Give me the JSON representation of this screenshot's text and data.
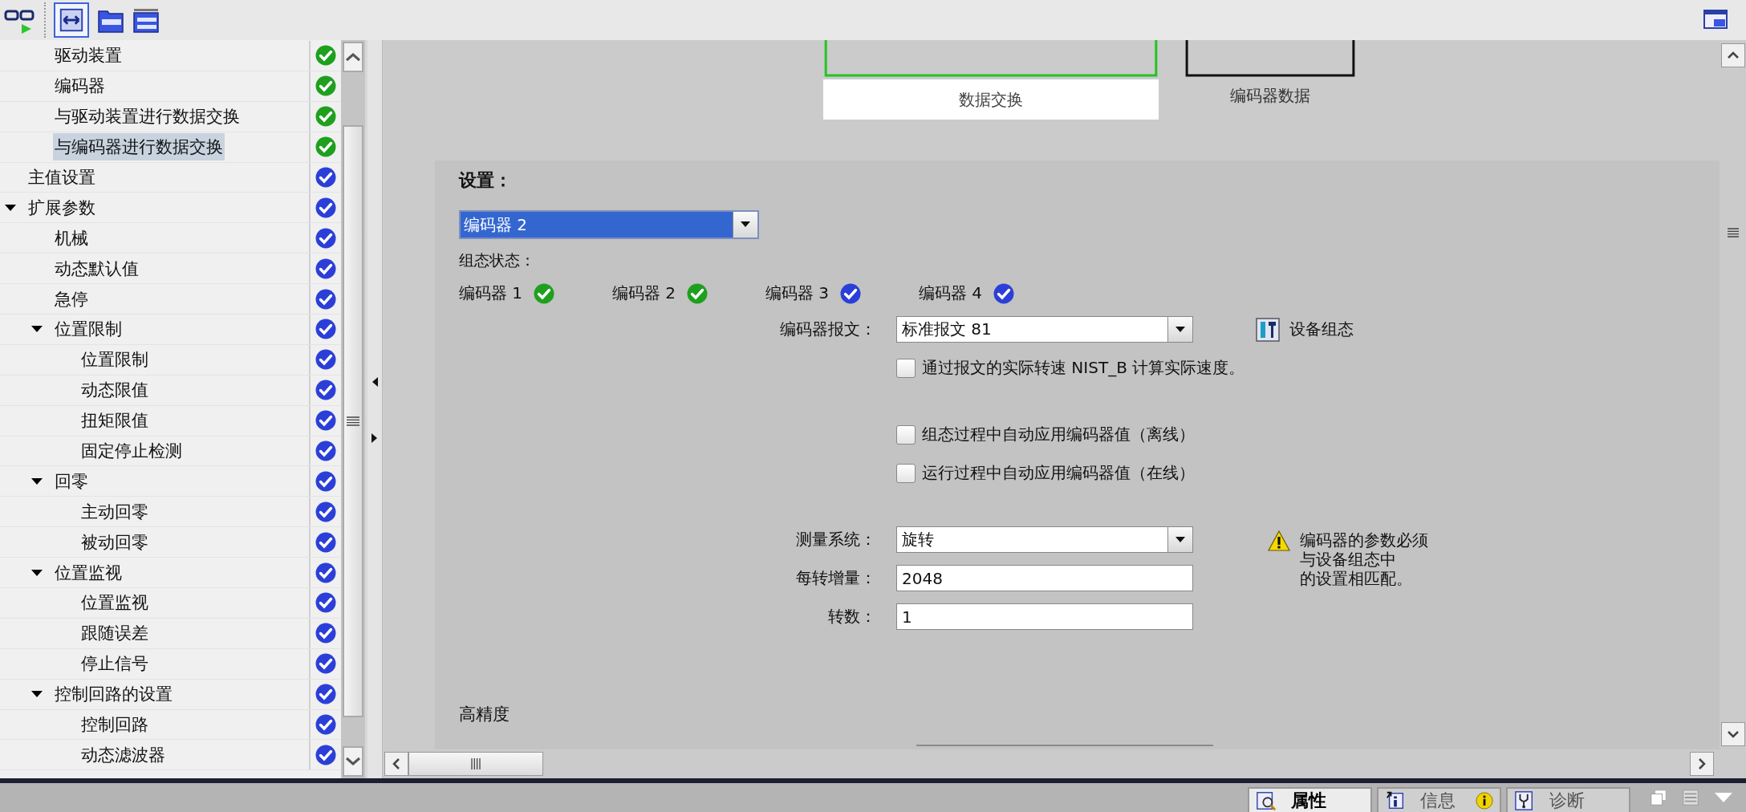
{
  "tree": {
    "items": [
      {
        "children": [
          {
            "label": "驱动装置",
            "selected": false,
            "color": "#1ea01e"
          },
          {
            "label": "编码器",
            "selected": false,
            "color": "#1ea01e"
          },
          {
            "label": "与驱动装置进行数据交换",
            "selected": false,
            "color": "#1ea01e"
          },
          {
            "label": "与编码器进行数据交换",
            "selected": true,
            "color": "#1ea01e"
          }
        ]
      },
      {
        "label": "主值设置",
        "selected": false,
        "color": "#2b3fd8"
      },
      {
        "label": "扩展参数",
        "selected": false,
        "color": "#2b3fd8",
        "expanded": true,
        "children": [
          {
            "label": "机械",
            "selected": false,
            "color": "#2b3fd8"
          },
          {
            "label": "动态默认值",
            "selected": false,
            "color": "#2b3fd8"
          },
          {
            "label": "急停",
            "selected": false,
            "color": "#2b3fd8"
          },
          {
            "label": "位置限制",
            "selected": false,
            "color": "#2b3fd8",
            "expanded": true,
            "children": [
              {
                "label": "位置限制",
                "selected": false,
                "color": "#2b3fd8"
              },
              {
                "label": "动态限值",
                "selected": false,
                "color": "#2b3fd8"
              },
              {
                "label": "扭矩限值",
                "selected": false,
                "color": "#2b3fd8"
              },
              {
                "label": "固定停止检测",
                "selected": false,
                "color": "#2b3fd8"
              }
            ]
          },
          {
            "label": "回零",
            "selected": false,
            "color": "#2b3fd8",
            "expanded": true,
            "children": [
              {
                "label": "主动回零",
                "selected": false,
                "color": "#2b3fd8"
              },
              {
                "label": "被动回零",
                "selected": false,
                "color": "#2b3fd8"
              }
            ]
          },
          {
            "label": "位置监视",
            "selected": false,
            "color": "#2b3fd8",
            "expanded": true,
            "children": [
              {
                "label": "位置监视",
                "selected": false,
                "color": "#2b3fd8"
              },
              {
                "label": "跟随误差",
                "selected": false,
                "color": "#2b3fd8"
              },
              {
                "label": "停止信号",
                "selected": false,
                "color": "#2b3fd8"
              }
            ]
          },
          {
            "label": "控制回路的设置",
            "selected": false,
            "color": "#2b3fd8",
            "expanded": true,
            "children": [
              {
                "label": "控制回路",
                "selected": false,
                "color": "#2b3fd8"
              },
              {
                "label": "动态滤波器",
                "selected": false,
                "color": "#2b3fd8"
              }
            ]
          }
        ]
      }
    ]
  },
  "diagram": {
    "blocks": [
      {
        "label": "数据交换",
        "kind": "boxed",
        "color": "#22c422"
      },
      {
        "label": "编码器数据",
        "kind": "plain",
        "color": "#111111"
      }
    ]
  },
  "settings": {
    "title": "设置：",
    "encoder_select": {
      "value": "编码器 2"
    },
    "status_label": "组态状态：",
    "encoders": [
      {
        "label": "编码器 1",
        "color": "#1ea01e"
      },
      {
        "label": "编码器 2",
        "color": "#1ea01e"
      },
      {
        "label": "编码器 3",
        "color": "#2b3fd8"
      },
      {
        "label": "编码器 4",
        "color": "#2b3fd8"
      }
    ],
    "groups": [
      [
        {
          "kind": "select",
          "label": "编码器报文：",
          "value": "标准报文 81"
        },
        {
          "kind": "checkbox",
          "label": "通过报文的实际转速 NIST_B 计算实际速度。",
          "checked": false
        }
      ],
      [
        {
          "kind": "checkbox",
          "label": "组态过程中自动应用编码器值（离线）",
          "checked": false
        },
        {
          "kind": "checkbox",
          "label": "运行过程中自动应用编码器值（在线）",
          "checked": false
        }
      ],
      [
        {
          "kind": "select",
          "label": "测量系统：",
          "value": "旋转"
        },
        {
          "kind": "text",
          "label": "每转增量：",
          "value": "2048"
        },
        {
          "kind": "text",
          "label": "转数：",
          "value": "1"
        }
      ]
    ],
    "device_config_button": {
      "label": "设备组态"
    },
    "warning": {
      "lines": [
        "编码器的参数必须",
        "与设备组态中",
        "的设置相匹配。"
      ]
    },
    "section_title": "高精度"
  },
  "bottom_tabs": [
    {
      "label": "属性",
      "selected": true,
      "kind": "properties"
    },
    {
      "label": "信息",
      "selected": false,
      "kind": "info"
    },
    {
      "label": "诊断",
      "selected": false,
      "kind": "diagnostics"
    }
  ]
}
